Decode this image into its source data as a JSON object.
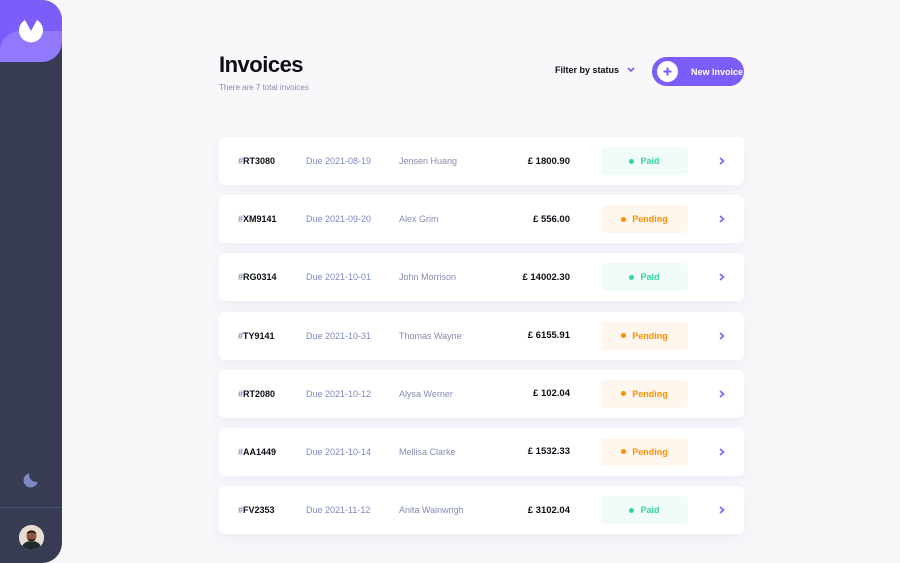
{
  "header": {
    "title": "Invoices",
    "subtitle": "There are 7 total invoices",
    "filter_label": "Filter by status",
    "new_invoice_label": "New Invoice"
  },
  "invoices": [
    {
      "id": "RT3080",
      "due": "Due 2021-08-19",
      "name": "Jensen Huang",
      "amount": "£ 1800.90",
      "status": "Paid"
    },
    {
      "id": "XM9141",
      "due": "Due 2021-09-20",
      "name": "Alex Grim",
      "amount": "£ 556.00",
      "status": "Pending"
    },
    {
      "id": "RG0314",
      "due": "Due 2021-10-01",
      "name": "John Morrison",
      "amount": "£ 14002.30",
      "status": "Paid"
    },
    {
      "id": "TY9141",
      "due": "Due 2021-10-31",
      "name": "Thomas Wayne",
      "amount": "£ 6155.91",
      "status": "Pending"
    },
    {
      "id": "RT2080",
      "due": "Due 2021-10-12",
      "name": "Alysa Werner",
      "amount": "£ 102.04",
      "status": "Pending"
    },
    {
      "id": "AA1449",
      "due": "Due 2021-10-14",
      "name": "Mellisa Clarke",
      "amount": "£ 1532.33",
      "status": "Pending"
    },
    {
      "id": "FV2353",
      "due": "Due 2021-11-12",
      "name": "Anita Wainwrigh",
      "amount": "£ 3102.04",
      "status": "Paid"
    }
  ],
  "icons": {
    "logo": "logo-icon",
    "theme": "moon-icon",
    "filter": "chevron-down-icon",
    "new": "plus-icon",
    "row": "chevron-right-icon"
  },
  "colors": {
    "accent": "#7c5dfa",
    "sidebar": "#373b53",
    "paid": "#33d69f",
    "pending": "#ff8f00"
  }
}
